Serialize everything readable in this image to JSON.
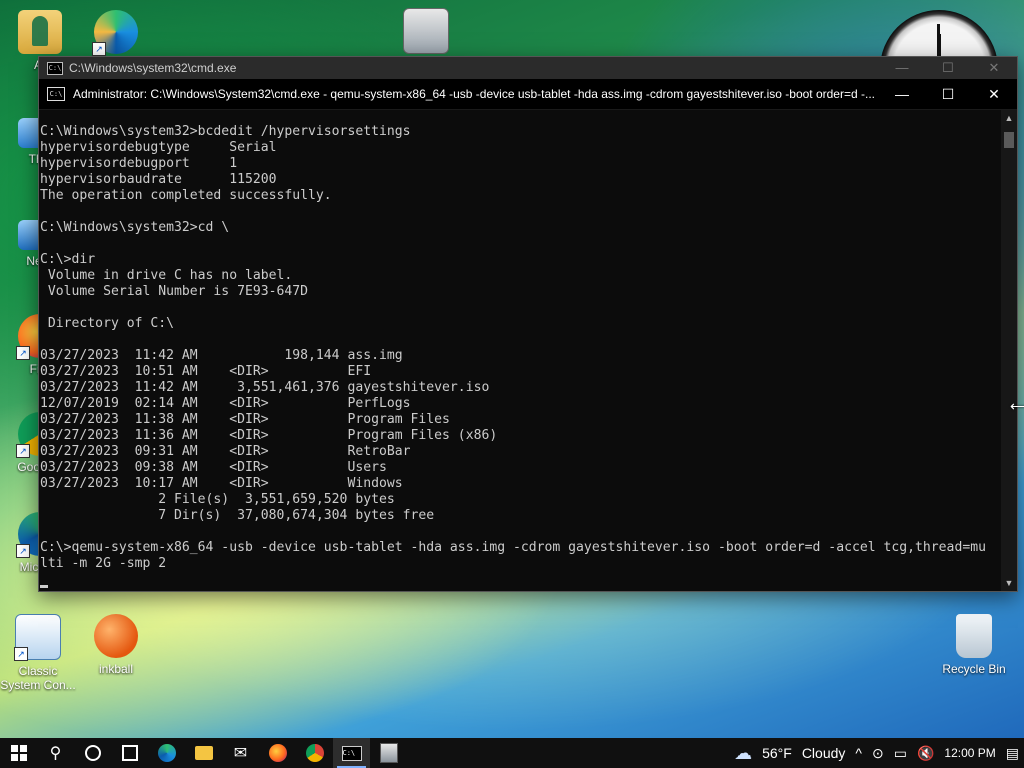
{
  "desktop": {
    "icons": [
      {
        "name": "user-folder",
        "label": "Ar"
      },
      {
        "name": "this-pc",
        "label": "This"
      },
      {
        "name": "network",
        "label": "Netw"
      },
      {
        "name": "firefox",
        "label": "Fire"
      },
      {
        "name": "google-chrome",
        "label": "Goo Chr"
      },
      {
        "name": "microsoft-edge",
        "label": "Micr Ed"
      },
      {
        "name": "classic-system-control",
        "label": "Classic System Con..."
      },
      {
        "name": "inkball",
        "label": "inkball"
      },
      {
        "name": "recycle-bin",
        "label": "Recycle Bin"
      }
    ]
  },
  "outer_window": {
    "title": "C:\\Windows\\system32\\cmd.exe",
    "minimize": "—",
    "maximize": "☐",
    "close": "✕"
  },
  "inner_window": {
    "title": "Administrator: C:\\Windows\\System32\\cmd.exe - qemu-system-x86_64  -usb -device usb-tablet -hda ass.img -cdrom gayestshitever.iso -boot order=d -...",
    "minimize": "—",
    "maximize": "☐",
    "close": "✕"
  },
  "console": {
    "lines": [
      "C:\\Windows\\system32>bcdedit /hypervisorsettings",
      "hypervisordebugtype     Serial",
      "hypervisordebugport     1",
      "hypervisorbaudrate      115200",
      "The operation completed successfully.",
      "",
      "C:\\Windows\\system32>cd \\",
      "",
      "C:\\>dir",
      " Volume in drive C has no label.",
      " Volume Serial Number is 7E93-647D",
      "",
      " Directory of C:\\",
      "",
      "03/27/2023  11:42 AM           198,144 ass.img",
      "03/27/2023  10:51 AM    <DIR>          EFI",
      "03/27/2023  11:42 AM     3,551,461,376 gayestshitever.iso",
      "12/07/2019  02:14 AM    <DIR>          PerfLogs",
      "03/27/2023  11:38 AM    <DIR>          Program Files",
      "03/27/2023  11:36 AM    <DIR>          Program Files (x86)",
      "03/27/2023  09:31 AM    <DIR>          RetroBar",
      "03/27/2023  09:38 AM    <DIR>          Users",
      "03/27/2023  10:17 AM    <DIR>          Windows",
      "               2 File(s)  3,551,659,520 bytes",
      "               7 Dir(s)  37,080,674,304 bytes free",
      "",
      "C:\\>qemu-system-x86_64 -usb -device usb-tablet -hda ass.img -cdrom gayestshitever.iso -boot order=d -accel tcg,thread=mu",
      "lti -m 2G -smp 2"
    ]
  },
  "taskbar": {
    "start_icon": "windows-logo",
    "items": [
      "search",
      "cortana",
      "task-view",
      "edge",
      "file-explorer",
      "mail",
      "firefox",
      "chrome",
      "cmd",
      "qemu"
    ],
    "weather_temp": "56°F",
    "weather_desc": "Cloudy",
    "tray_chevron": "^",
    "time": "12:00 PM"
  },
  "colors": {
    "console_bg": "#0c0c0c",
    "console_fg": "#cccccc",
    "taskbar_bg": "#101010"
  }
}
